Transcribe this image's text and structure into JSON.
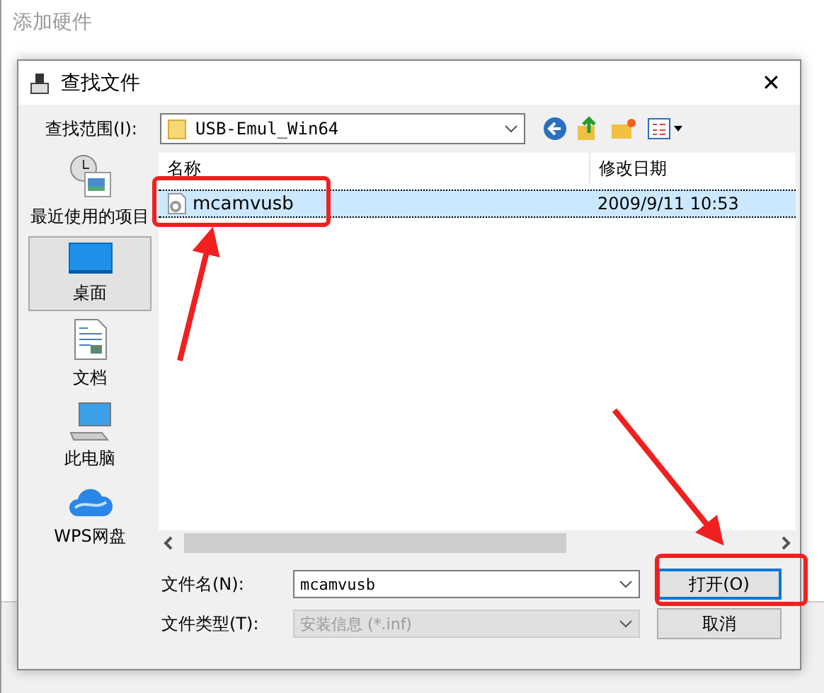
{
  "background_window": {
    "title": "添加硬件"
  },
  "dialog": {
    "title": "查找文件",
    "close": "✕"
  },
  "look_in": {
    "label": "查找范围(I):",
    "value": "USB-Emul_Win64"
  },
  "places": [
    {
      "label": "最近使用的项目",
      "kind": "recent",
      "selected": false
    },
    {
      "label": "桌面",
      "kind": "desktop",
      "selected": true
    },
    {
      "label": "文档",
      "kind": "documents",
      "selected": false
    },
    {
      "label": "此电脑",
      "kind": "computer",
      "selected": false
    },
    {
      "label": "WPS网盘",
      "kind": "cloud",
      "selected": false
    }
  ],
  "file_list": {
    "columns": [
      "名称",
      "修改日期"
    ],
    "rows": [
      {
        "name": "mcamvusb",
        "modified": "2009/9/11 10:53",
        "selected": true
      }
    ]
  },
  "file_name": {
    "label": "文件名(N):",
    "value": "mcamvusb"
  },
  "file_type": {
    "label": "文件类型(T):",
    "value": "安装信息 (*.inf)",
    "disabled": true
  },
  "buttons": [
    {
      "label": "打开(O)",
      "default": true
    },
    {
      "label": "取消",
      "default": false
    }
  ]
}
